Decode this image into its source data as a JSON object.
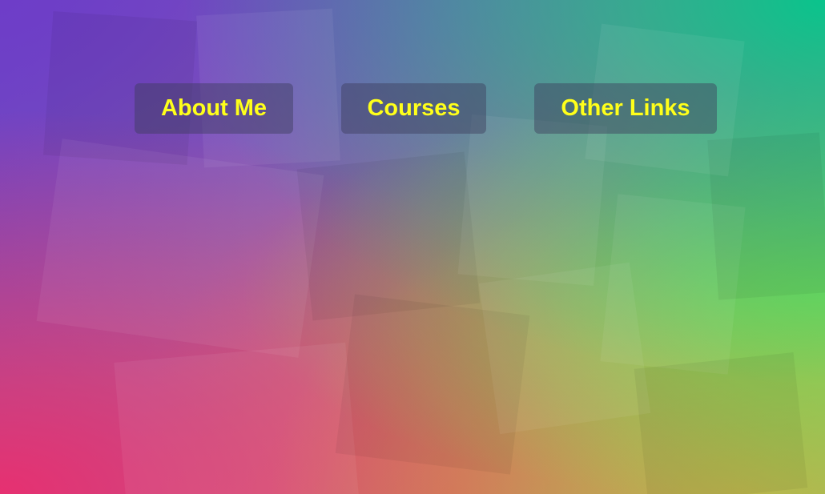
{
  "nav": {
    "items": [
      {
        "label": "About Me"
      },
      {
        "label": "Courses"
      },
      {
        "label": "Other Links"
      }
    ],
    "text_color": "#ffff1a",
    "button_background": "rgba(60,60,90,0.45)"
  },
  "background": {
    "colors": [
      "#6a4bc4",
      "#00c88c",
      "#78dc50",
      "#eb2d6e",
      "#d76e5a"
    ]
  }
}
